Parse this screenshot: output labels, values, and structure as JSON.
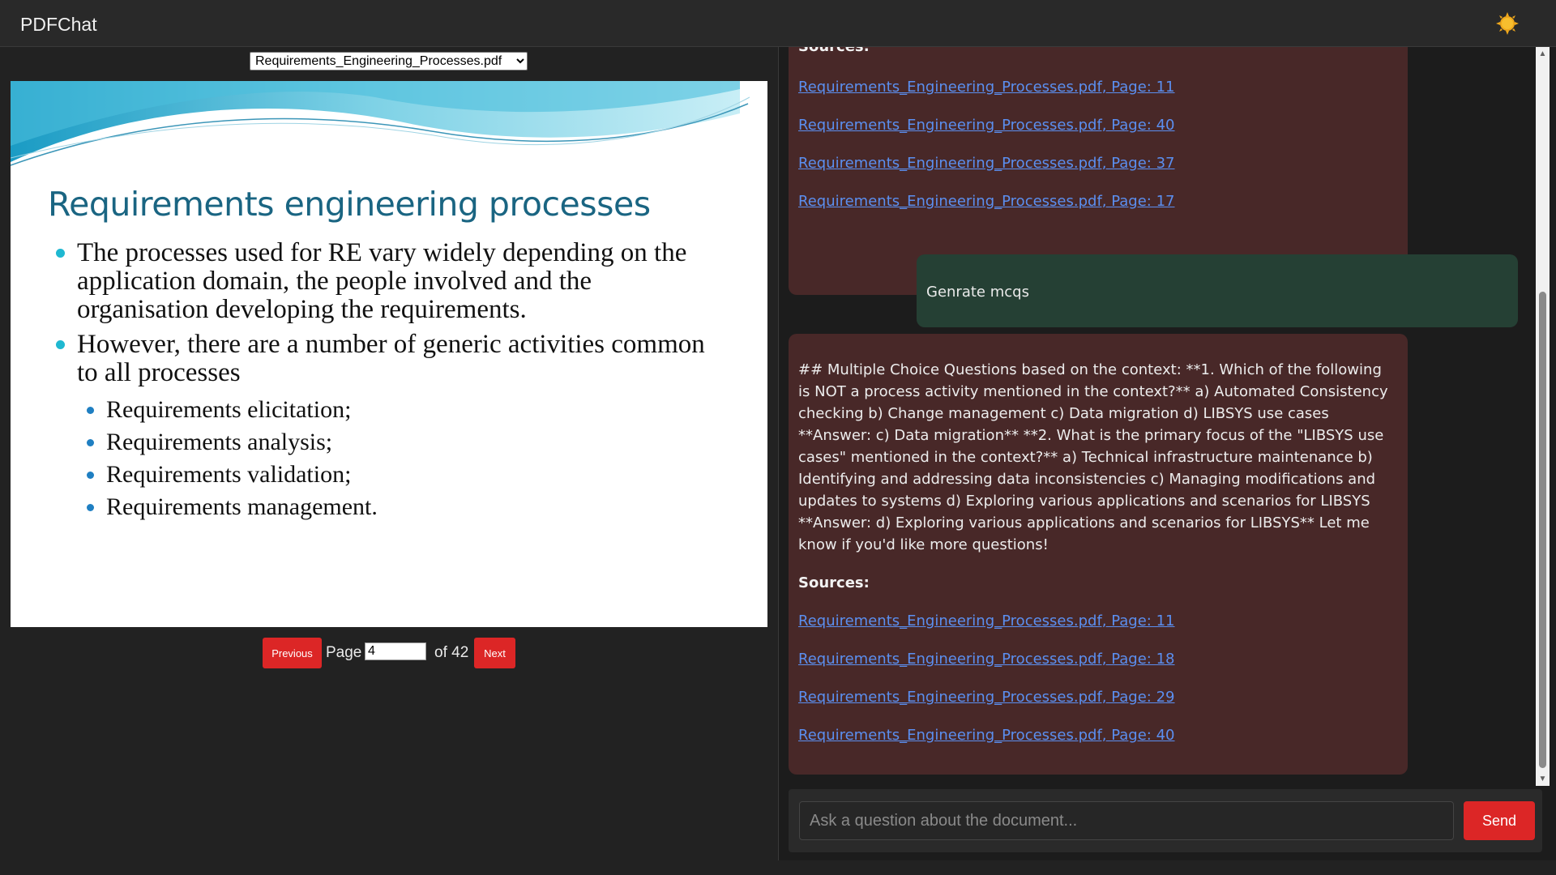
{
  "app": {
    "title": "PDFChat"
  },
  "viewer": {
    "selected_file": "Requirements_Engineering_Processes.pdf",
    "slide": {
      "title": "Requirements engineering processes",
      "bullets": [
        "The processes used for RE vary widely depending on the application domain, the people involved and the organisation developing the requirements.",
        "However, there are a number of generic activities common to all processes"
      ],
      "sub_bullets": [
        "Requirements elicitation;",
        "Requirements analysis;",
        "Requirements validation;",
        "Requirements management."
      ]
    },
    "pager": {
      "previous_label": "Previous",
      "page_label": "Page",
      "current_page": "4",
      "of_label": "of 42",
      "next_label": "Next"
    }
  },
  "chat": {
    "messages": [
      {
        "role": "ai",
        "sources_label": "Sources:",
        "sources": [
          "Requirements_Engineering_Processes.pdf, Page: 11",
          "Requirements_Engineering_Processes.pdf, Page: 40",
          "Requirements_Engineering_Processes.pdf, Page: 37",
          "Requirements_Engineering_Processes.pdf, Page: 17"
        ]
      },
      {
        "role": "user",
        "text": "Genrate mcqs"
      },
      {
        "role": "ai",
        "text": "## Multiple Choice Questions based on the context: **1. Which of the following is NOT a process activity mentioned in the context?** a) Automated Consistency checking b) Change management c) Data migration d) LIBSYS use cases **Answer: c) Data migration** **2. What is the primary focus of the \"LIBSYS use cases\" mentioned in the context?** a) Technical infrastructure maintenance b) Identifying and addressing data inconsistencies c) Managing modifications and updates to systems d) Exploring various applications and scenarios for LIBSYS **Answer: d) Exploring various applications and scenarios for LIBSYS** Let me know if you'd like more questions!",
        "sources_label": "Sources:",
        "sources": [
          "Requirements_Engineering_Processes.pdf, Page: 11",
          "Requirements_Engineering_Processes.pdf, Page: 18",
          "Requirements_Engineering_Processes.pdf, Page: 29",
          "Requirements_Engineering_Processes.pdf, Page: 40"
        ]
      }
    ],
    "input": {
      "placeholder": "Ask a question about the document...",
      "value": ""
    },
    "send_label": "Send"
  },
  "colors": {
    "accent_red": "#dc2626",
    "ai_bubble": "#482828",
    "user_bubble": "#254034",
    "link": "#5b8ff0",
    "slide_title": "#1a6582"
  },
  "icons": {
    "theme_toggle": "sun-icon",
    "select_arrow": "chevron-down-icon"
  }
}
